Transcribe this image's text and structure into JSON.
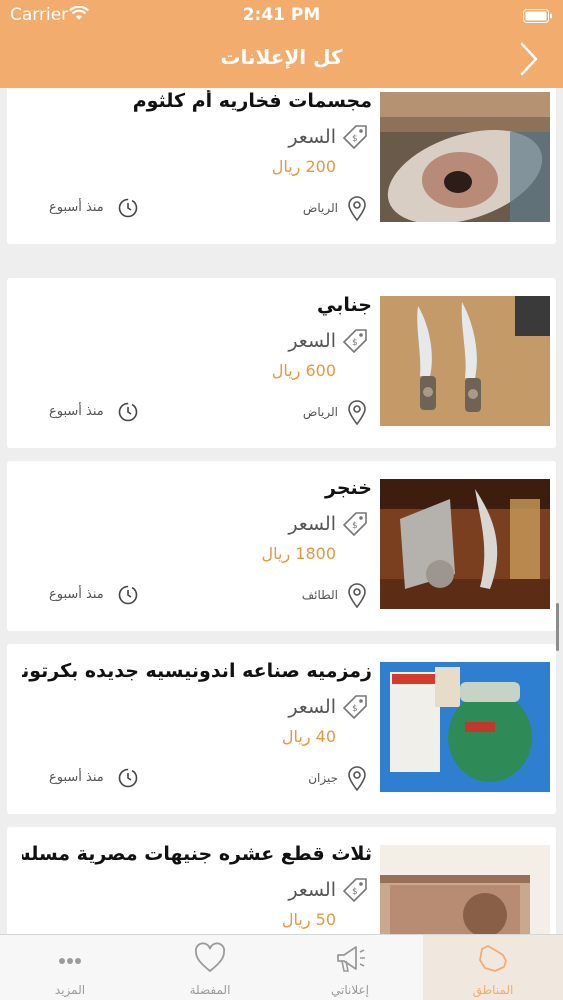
{
  "status": {
    "carrier": "Carrier",
    "time": "2:41 PM"
  },
  "nav": {
    "title": "كل الإعلانات"
  },
  "ads": [
    {
      "title": "مجسمات فخاريه أم كلثوم",
      "price_label": "السعر",
      "price": "200 ريال",
      "city": "الرياض",
      "time": "منذ أسبوع"
    },
    {
      "title": "جنابي",
      "price_label": "السعر",
      "price": "600 ريال",
      "city": "الرياض",
      "time": "منذ أسبوع"
    },
    {
      "title": "خنجر",
      "price_label": "السعر",
      "price": "1800 ريال",
      "city": "الطائف",
      "time": "منذ أسبوع"
    },
    {
      "title": "زمزميه صناعه اندونيسيه جديده بكرتونها...",
      "price_label": "السعر",
      "price": "40 ريال",
      "city": "جيزان",
      "time": "منذ أسبوع"
    },
    {
      "title": "ثلاث قطع عشره جنيهات مصرية مسلسل",
      "price_label": "السعر",
      "price": "50 ريال",
      "city": "",
      "time": ""
    }
  ],
  "tabs": [
    {
      "label": "المزيد",
      "icon": "more-icon"
    },
    {
      "label": "المفضلة",
      "icon": "heart-icon"
    },
    {
      "label": "إعلاناتي",
      "icon": "megaphone-icon"
    },
    {
      "label": "المناطق",
      "icon": "map-icon"
    }
  ],
  "colors": {
    "accent": "#f2ac6e",
    "price": "#e9963f"
  }
}
